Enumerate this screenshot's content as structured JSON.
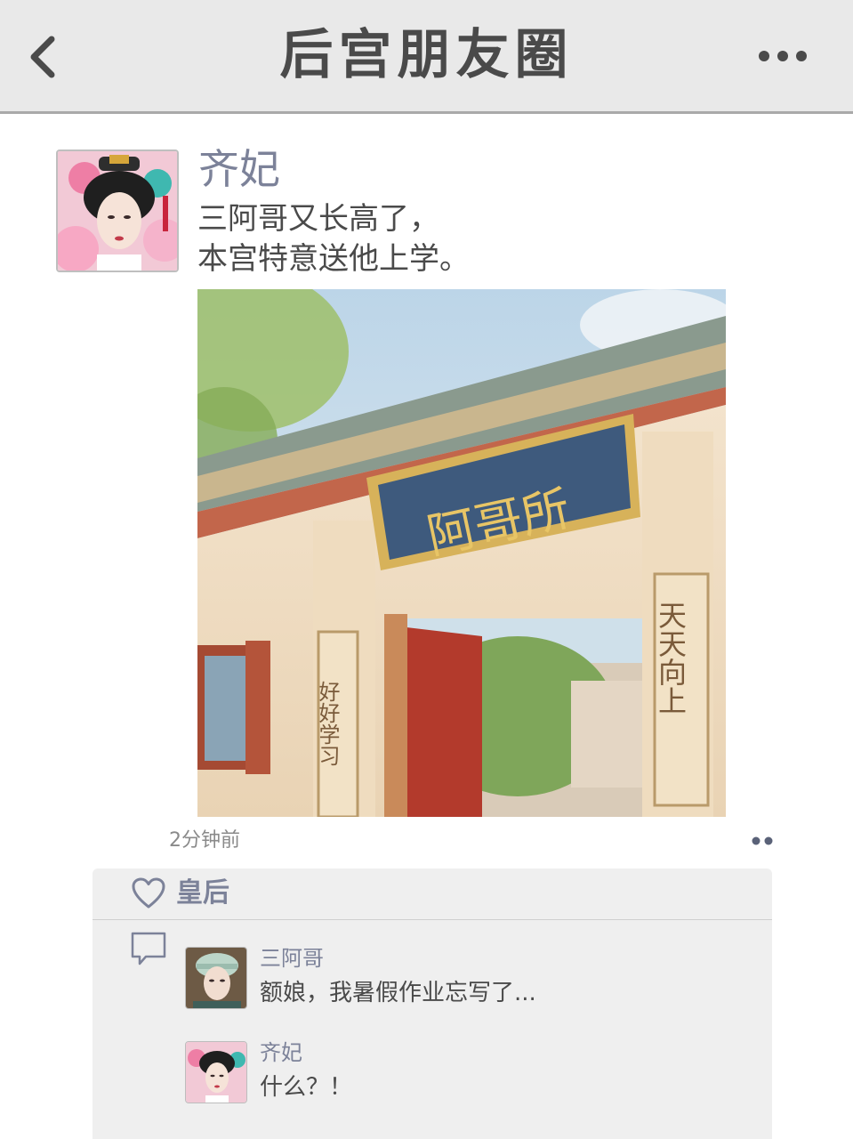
{
  "header": {
    "title": "后宫朋友圈",
    "back_icon": "chevron-left-icon",
    "more_icon": "more-horizontal-icon"
  },
  "post": {
    "author": "齐妃",
    "text": "三阿哥又长高了，\n本宫特意送他上学。",
    "time": "2分钟前",
    "image": {
      "plaque": "阿哥所",
      "left_couplet": "好好学习",
      "right_couplet": "天天向上"
    }
  },
  "likes": {
    "icon": "heart-icon",
    "names": "皇后"
  },
  "comments_icon": "comment-bubble-icon",
  "comments": [
    {
      "author": "三阿哥",
      "text": "额娘，我暑假作业忘写了..."
    },
    {
      "author": "齐妃",
      "text": "什么？！"
    }
  ],
  "colors": {
    "name": "#7c8299",
    "header_bg": "#e9e9e9",
    "panel_bg": "#efefef"
  }
}
